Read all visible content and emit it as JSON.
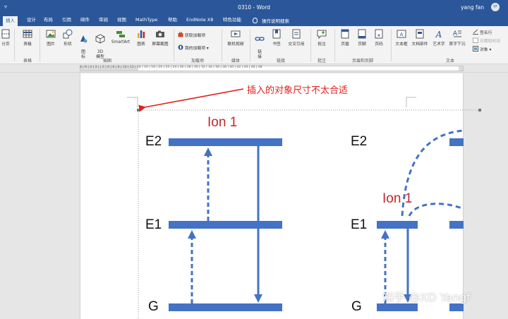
{
  "window": {
    "quick_access": "▿",
    "title": "0310  -  Word",
    "user": "yang fan",
    "avatar_initials": "YF"
  },
  "tabs": [
    {
      "label": "插入",
      "active": true
    },
    {
      "label": "设计"
    },
    {
      "label": "布局"
    },
    {
      "label": "引用"
    },
    {
      "label": "邮件"
    },
    {
      "label": "审阅"
    },
    {
      "label": "视图"
    },
    {
      "label": "MathType"
    },
    {
      "label": "帮助"
    },
    {
      "label": "EndNote X8"
    },
    {
      "label": "特色功能"
    }
  ],
  "tell_me": "操作说明搜索",
  "ribbon": {
    "page_break": "分页",
    "table": "表格",
    "picture": "图片",
    "shapes": "形状",
    "icons": "图\n标",
    "model3d": "3D\n模型",
    "smartart": "SmartArt",
    "chart": "图表",
    "screenshot": "屏幕截图",
    "get_addins": "获取加载项",
    "my_addins": "我的加载项",
    "online_video": "联机视频",
    "link": "链\n接",
    "bookmark": "书签",
    "cross_ref": "交叉引用",
    "comment": "批注",
    "header": "页眉",
    "footer": "页脚",
    "page_number": "页码",
    "textbox": "文本框",
    "quick_parts": "文档部件",
    "wordart": "艺术字",
    "dropcap": "首字下沉",
    "signature_line": "签名行",
    "date_time": "日期和时间",
    "object": "对象",
    "groups": {
      "tables": "表格",
      "illustrations": "插图",
      "addins": "加载项",
      "media": "媒体",
      "links": "链接",
      "comments": "批注",
      "header_footer": "页眉和页脚",
      "text": "文本"
    }
  },
  "ruler_numbers": "8 | 6 | 4 | 2 |     | 2 | 4 | 6 | 8 | 10 | 12 | 14 | 16 | 18 | 20 | 22 | 24 | 26 | 28 | 30 | 32 | 34 | 36 | 38 | 40 | 42 | 44 | 46 | 48",
  "annotation": "插入的对象尺寸不太合适",
  "figure": {
    "left": {
      "title": "Ion 1",
      "levels": [
        "E2",
        "E1",
        "G"
      ]
    },
    "right": {
      "title": "Ion 1",
      "levels": [
        "E2",
        "E1",
        "G"
      ]
    }
  },
  "colors": {
    "word_blue": "#2b579a",
    "level_blue": "#4472c4",
    "title_red": "#c0282b",
    "annotation_red": "#e0201a"
  },
  "watermark": "知乎 @XD Yangf"
}
